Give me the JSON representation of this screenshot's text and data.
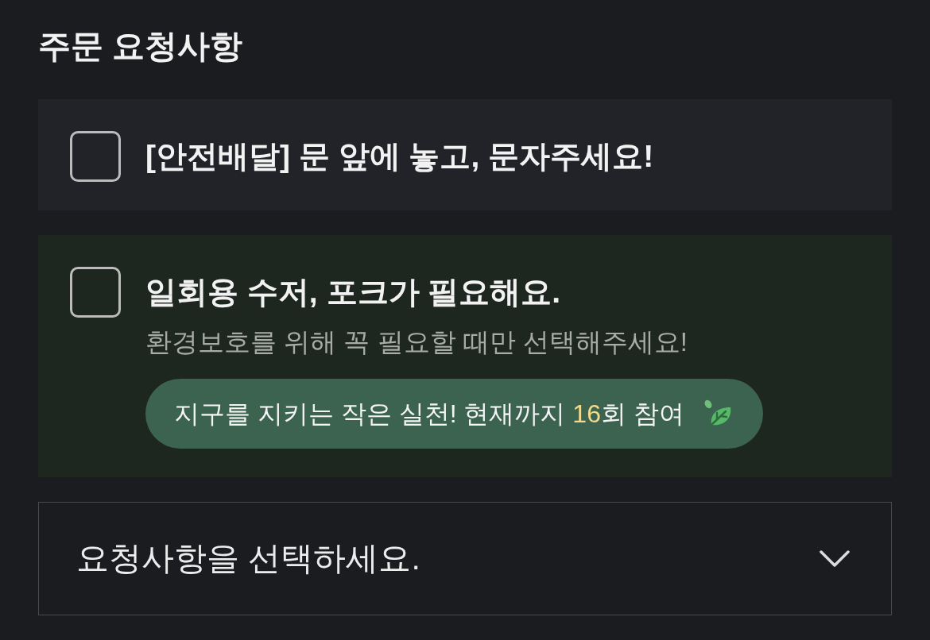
{
  "title": "주문 요청사항",
  "options": [
    {
      "kind": "plain",
      "checked": false,
      "label": "[안전배달] 문 앞에 놓고, 문자주세요!"
    },
    {
      "kind": "eco",
      "checked": false,
      "label": "일회용 수저, 포크가 필요해요.",
      "note": "환경보호를 위해 꼭 필요할 때만 선택해주세요!",
      "badge": {
        "text_before": "지구를 지키는 작은 실천! 현재까지 ",
        "count": "16",
        "text_after": "회 참여"
      }
    }
  ],
  "dropdown": {
    "placeholder": "요청사항을 선택하세요."
  }
}
